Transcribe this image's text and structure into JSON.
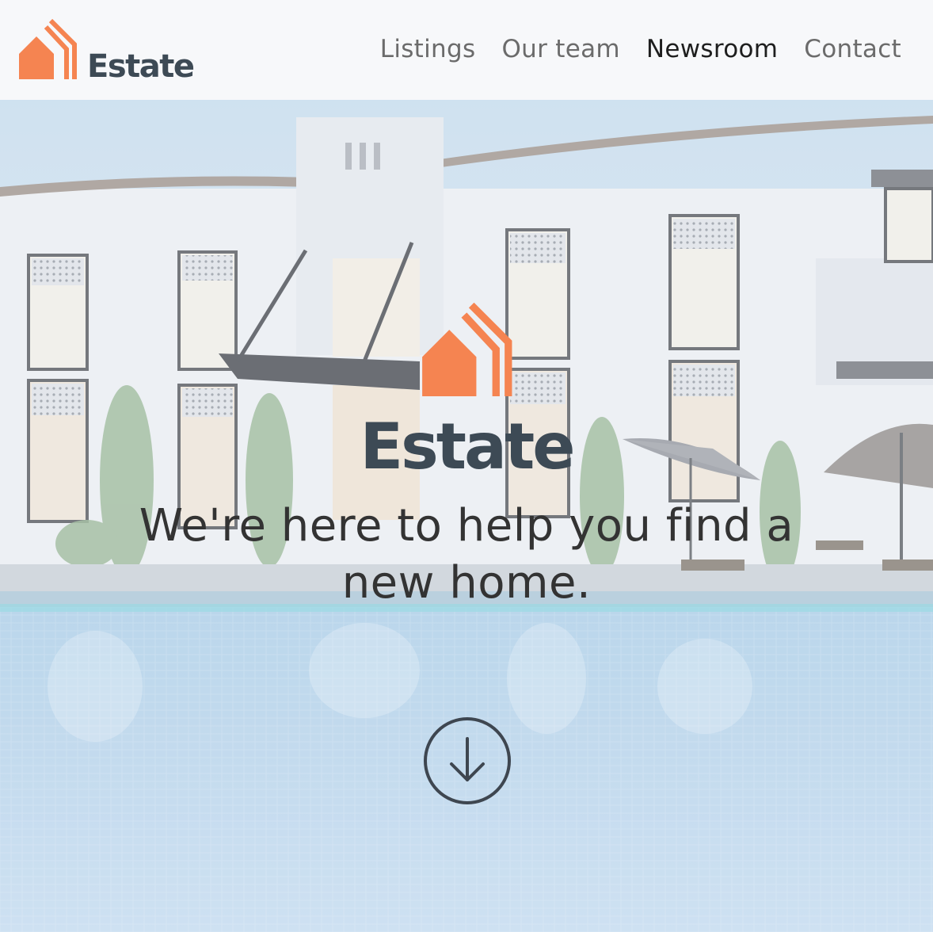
{
  "brand": {
    "name": "Estate",
    "logo_icon": "house-logo-icon",
    "accent_color": "#f58451",
    "text_color": "#3d4a55"
  },
  "nav": {
    "items": [
      {
        "label": "Listings",
        "active": false
      },
      {
        "label": "Our team",
        "active": false
      },
      {
        "label": "Newsroom",
        "active": true
      },
      {
        "label": "Contact",
        "active": false
      }
    ]
  },
  "hero": {
    "brand_name": "Estate",
    "tagline": "We're here to help you find a new home.",
    "scroll_icon": "arrow-down-circle-icon"
  }
}
